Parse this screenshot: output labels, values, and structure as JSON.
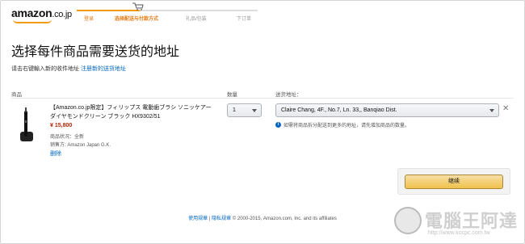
{
  "header": {
    "logo_main": "amazon",
    "logo_suffix": ".co.jp",
    "steps": [
      "登录",
      "选择配送与付款方式",
      "礼品/包装",
      "下订单"
    ]
  },
  "page": {
    "title": "选择每件商品需要送货的地址",
    "subtitle_text": "请击右键輸入新的收件地址",
    "subtitle_link": "注册新的送货地址"
  },
  "columns": {
    "product": "商品",
    "quantity": "数量",
    "address": "送货地址："
  },
  "item": {
    "name": "【Amazon.co.jp限定】フィリップス 電動歯ブラシ ソニッケアー ダイヤモンドクリーン ブラック HX9302/51",
    "price": "¥ 15,800",
    "condition": "商品状况：全新",
    "seller": "销售方: Amazon Japan G.K.",
    "delete_label": "删除",
    "quantity": "1",
    "address": "Claire Chang, 4F., No.7, Ln. 33,, Banqiao Dist.",
    "info_text": "如需将商品拆分配送到更多的地址，请先增加商品的数量。"
  },
  "actions": {
    "continue_label": "继续"
  },
  "footer": {
    "terms": "使用规章",
    "privacy": "隐私规章",
    "copyright": "© 2000-2015, Amazon.com, Inc. and its affiliates"
  },
  "watermark": {
    "text": "電腦王阿達",
    "url": "http://www.kocpc.com.tw"
  },
  "colors": {
    "accent": "#f39c12",
    "link": "#0066c0",
    "price": "#b12704",
    "button": "#f0c14b"
  }
}
